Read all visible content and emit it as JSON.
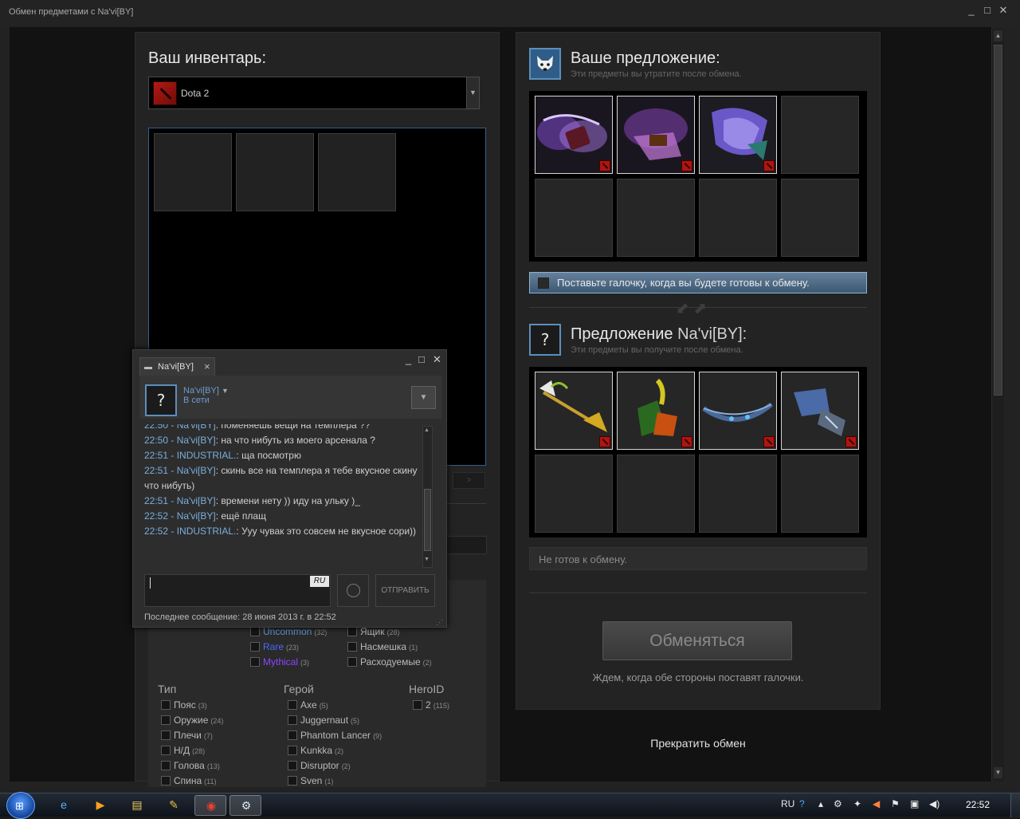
{
  "window": {
    "title": "Обмен предметами с Na'vi[BY]",
    "minimize": "_",
    "maximize": "□",
    "close": "✕"
  },
  "inventory": {
    "title": "Ваш инвентарь:",
    "game": "Dota 2",
    "next_page": ">"
  },
  "filters": {
    "rarity": [
      {
        "label": "Uncommon",
        "count": "(32)",
        "color": "#5e98d9"
      },
      {
        "label": "Rare",
        "count": "(23)",
        "color": "#4b69ff"
      },
      {
        "label": "Mythical",
        "count": "(3)",
        "color": "#8847ff"
      }
    ],
    "misc": [
      {
        "label": "Ящик",
        "count": "(28)"
      },
      {
        "label": "Насмешка",
        "count": "(1)"
      },
      {
        "label": "Расходуемые",
        "count": "(2)"
      }
    ],
    "type_title": "Тип",
    "type": [
      {
        "label": "Пояс",
        "count": "(3)"
      },
      {
        "label": "Оружие",
        "count": "(24)"
      },
      {
        "label": "Плечи",
        "count": "(7)"
      },
      {
        "label": "Н/Д",
        "count": "(28)"
      },
      {
        "label": "Голова",
        "count": "(13)"
      },
      {
        "label": "Спина",
        "count": "(11)"
      }
    ],
    "hero_title": "Герой",
    "hero": [
      {
        "label": "Axe",
        "count": "(5)"
      },
      {
        "label": "Juggernaut",
        "count": "(5)"
      },
      {
        "label": "Phantom Lancer",
        "count": "(9)"
      },
      {
        "label": "Kunkka",
        "count": "(2)"
      },
      {
        "label": "Disruptor",
        "count": "(2)"
      },
      {
        "label": "Sven",
        "count": "(1)"
      }
    ],
    "heroid_title": "HeroID",
    "heroid": [
      {
        "label": "2",
        "count": "(115)"
      }
    ]
  },
  "your_offer": {
    "title": "Ваше предложение:",
    "subtitle": "Эти предметы вы утратите после обмена.",
    "ready_label": "Поставьте галочку, когда вы будете готовы к обмену."
  },
  "their_offer": {
    "title_prefix": "Предложение",
    "title_name": "Na'vi[BY]:",
    "subtitle": "Эти предметы вы получите после обмена."
  },
  "status": "Не готов к обмену.",
  "trade_button": "Обменяться",
  "wait_text": "Ждем, когда обе стороны поставят галочки.",
  "cancel_link": "Прекратить обмен",
  "chat": {
    "tab_label": "Na'vi[BY]",
    "friend_name": "Na'vi[BY]",
    "friend_status": "В сети",
    "messages": [
      {
        "time": "22:50",
        "who": "Na'vi[BY]",
        "text": "поменяешь  вещи на темплера ??",
        "y": -4
      },
      {
        "time": "22:50",
        "who": "Na'vi[BY]",
        "text": "на что нибуть из моего арсенала ?"
      },
      {
        "time": "22:51",
        "who": "INDUSTRIAL.",
        "text": "ща посмотрю"
      },
      {
        "time": "22:51",
        "who": "Na'vi[BY]",
        "text": "скинь  все на темплера я тебе вкусное скину что нибуть)"
      },
      {
        "time": "22:51",
        "who": "Na'vi[BY]",
        "text": "времени нету ))  иду на ульку )_"
      },
      {
        "time": "22:52",
        "who": "Na'vi[BY]",
        "text": "ещё плащ"
      },
      {
        "time": "22:52",
        "who": "INDUSTRIAL.",
        "text": "Ууу чувак это совсем не вкусное сори))"
      }
    ],
    "lang": "RU",
    "send": "ОТПРАВИТЬ",
    "last_message": "Последнее сообщение: 28 июня 2013 г. в 22:52"
  },
  "taskbar": {
    "lang": "RU",
    "clock": "22:52"
  }
}
